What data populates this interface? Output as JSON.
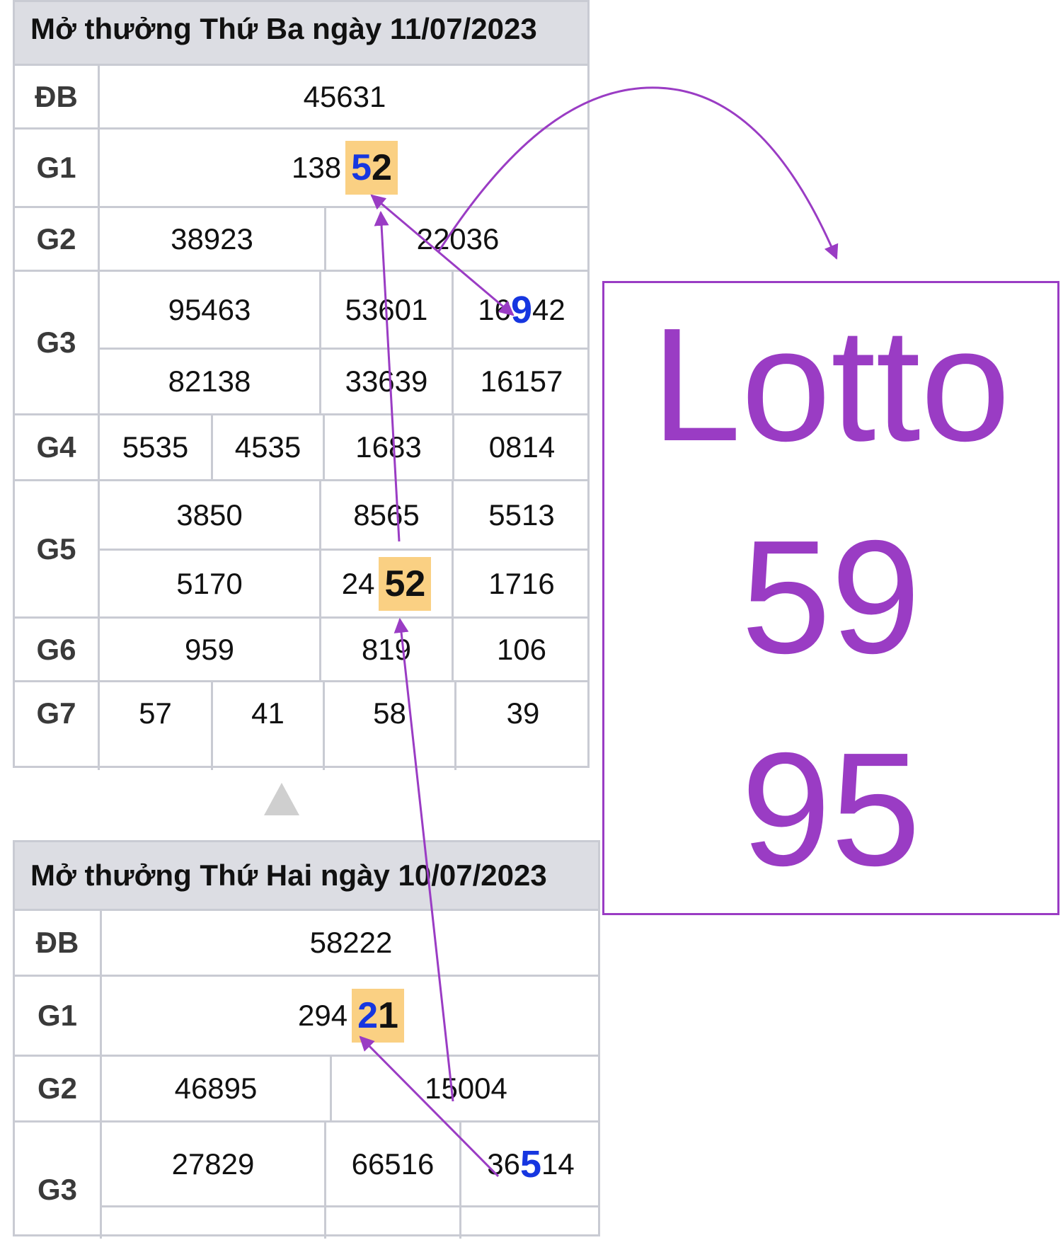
{
  "board1": {
    "title": "Mở thưởng Thứ Ba ngày 11/07/2023",
    "db_label": "ĐB",
    "db": "45631",
    "g1_label": "G1",
    "g1_prefix": "138",
    "g1_hl_a": "5",
    "g1_hl_b": "2",
    "g2_label": "G2",
    "g2": [
      "38923",
      "22036"
    ],
    "g3_label": "G3",
    "g3_row1": [
      "95463",
      "53601"
    ],
    "g3_row1_c3": {
      "pre": "16",
      "mark": "9",
      "post": "42"
    },
    "g3_row2": [
      "82138",
      "33639",
      "16157"
    ],
    "g4_label": "G4",
    "g4": [
      "5535",
      "4535",
      "1683",
      "0814"
    ],
    "g5_label": "G5",
    "g5_row1": [
      "3850",
      "8565",
      "5513"
    ],
    "g5_row2_c1": "5170",
    "g5_row2_c2": {
      "pre": "24",
      "hl": "52"
    },
    "g5_row2_c3": "1716",
    "g6_label": "G6",
    "g6": [
      "959",
      "819",
      "106"
    ],
    "g7_label": "G7",
    "g7": [
      "57",
      "41",
      "58",
      "39"
    ]
  },
  "board2": {
    "title": "Mở thưởng Thứ Hai ngày 10/07/2023",
    "db_label": "ĐB",
    "db": "58222",
    "g1_label": "G1",
    "g1_prefix": "294",
    "g1_hl_a": "2",
    "g1_hl_b": "1",
    "g2_label": "G2",
    "g2": [
      "46895",
      "15004"
    ],
    "g3_label": "G3",
    "g3_row1": [
      "27829",
      "66516"
    ],
    "g3_row1_c3": {
      "pre": "36",
      "mark": "5",
      "post": "14"
    }
  },
  "lotto": {
    "heading": "Lotto",
    "numbers": [
      "59",
      "95"
    ]
  },
  "colors": {
    "accent": "#9a3cc4",
    "highlight": "#fad083",
    "digit_blue": "#1636e0",
    "header_bg": "#dcdde3",
    "grid": "#c9cbd3"
  },
  "icons": {
    "collapse": "triangle-up-icon"
  }
}
